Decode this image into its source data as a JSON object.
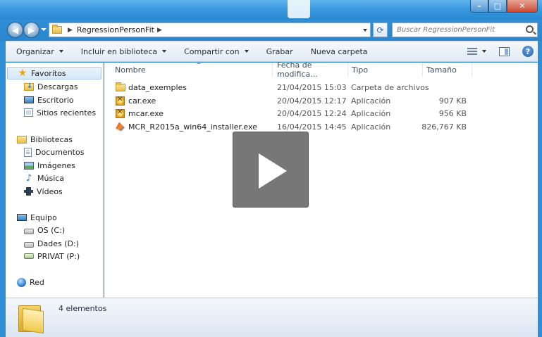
{
  "address": {
    "path": [
      "RegressionPersonFit"
    ],
    "search_placeholder": "Buscar RegressionPersonFit"
  },
  "toolbar": {
    "organize": "Organizar",
    "include_library": "Incluir en biblioteca",
    "share": "Compartir con",
    "burn": "Grabar",
    "new_folder": "Nueva carpeta"
  },
  "nav": {
    "favorites": "Favoritos",
    "downloads": "Descargas",
    "desktop": "Escritorio",
    "recent": "Sitios recientes",
    "libraries": "Bibliotecas",
    "documents": "Documentos",
    "images": "Imágenes",
    "music": "Música",
    "videos": "Vídeos",
    "computer": "Equipo",
    "drive_c": "OS (C:)",
    "drive_d": "Dades (D:)",
    "drive_p": "PRIVAT (P:)",
    "network": "Red"
  },
  "columns": {
    "name": "Nombre",
    "date": "Fecha de modifica...",
    "type": "Tipo",
    "size": "Tamaño"
  },
  "files": [
    {
      "name": "data_exemples",
      "date": "21/04/2015 15:03",
      "type": "Carpeta de archivos",
      "size": "",
      "icon": "folder-icon"
    },
    {
      "name": "car.exe",
      "date": "20/04/2015 12:17",
      "type": "Aplicación",
      "size": "907 KB",
      "icon": "exe-icon"
    },
    {
      "name": "mcar.exe",
      "date": "20/04/2015 12:24",
      "type": "Aplicación",
      "size": "956 KB",
      "icon": "exe-icon"
    },
    {
      "name": "MCR_R2015a_win64_installer.exe",
      "date": "16/04/2015 14:45",
      "type": "Aplicación",
      "size": "826,767 KB",
      "icon": "matlab-icon"
    }
  ],
  "status": {
    "count": "4 elementos"
  }
}
